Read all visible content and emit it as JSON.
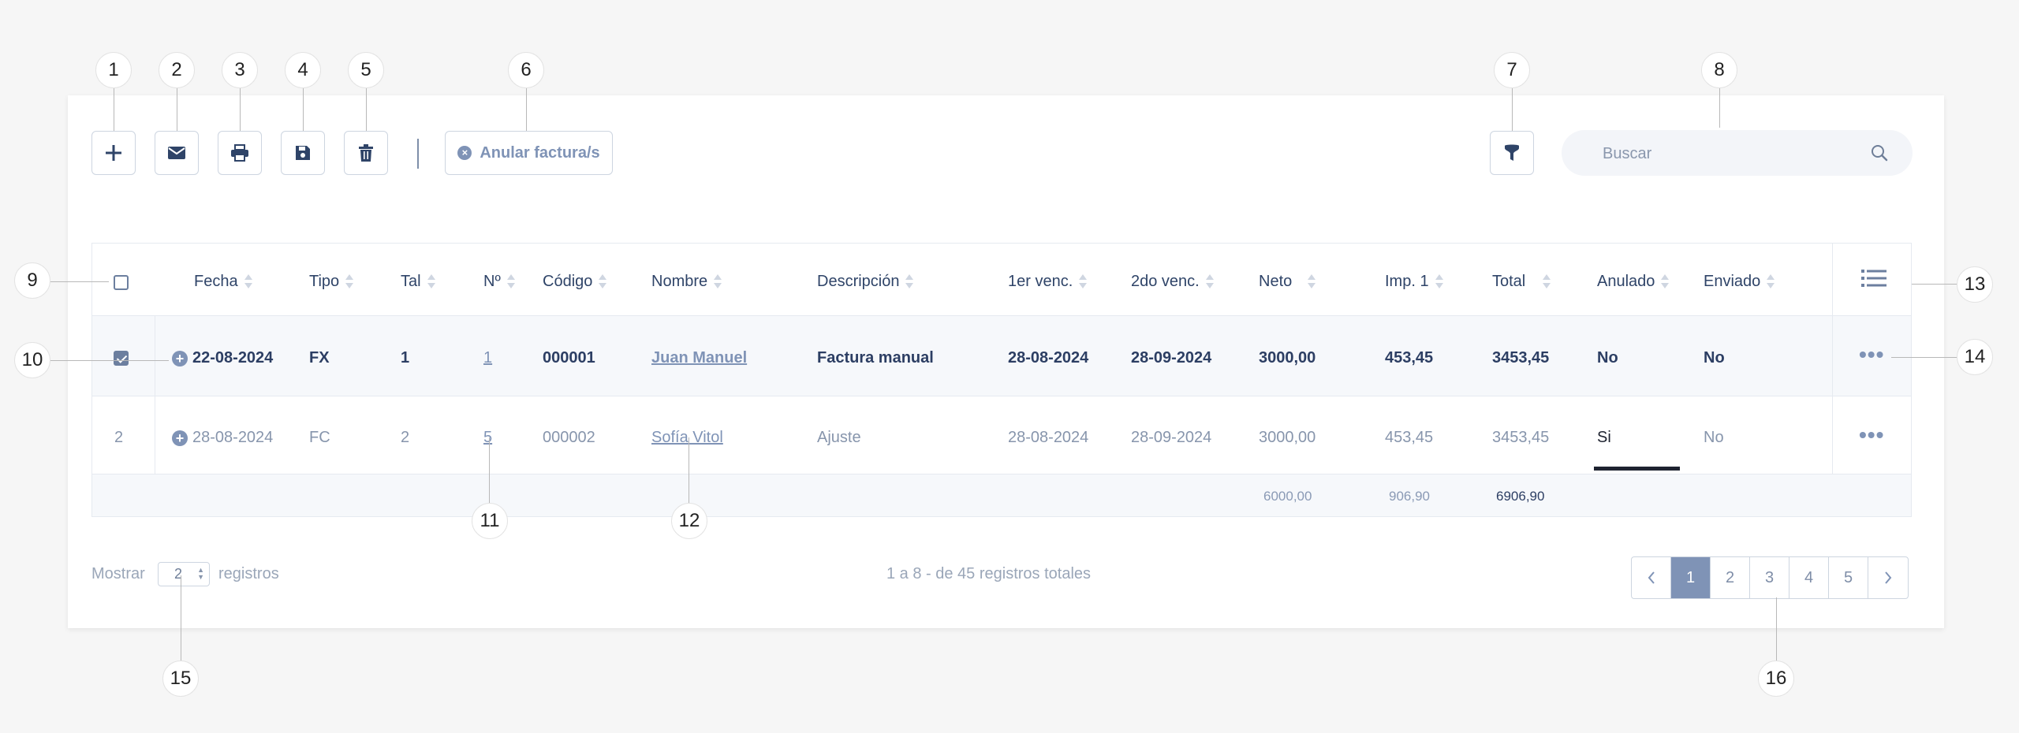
{
  "toolbar": {
    "annul_label": "Anular factura/s"
  },
  "search": {
    "placeholder": "Buscar"
  },
  "table": {
    "headers": [
      "Fecha",
      "Tipo",
      "Tal",
      "Nº",
      "Código",
      "Nombre",
      "Descripción",
      "1er venc.",
      "2do venc.",
      "Neto",
      "Imp. 1",
      "Total",
      "Anulado",
      "Enviado"
    ],
    "rows": [
      {
        "index": "",
        "checked": true,
        "fecha": "22-08-2024",
        "tipo": "FX",
        "tal": "1",
        "numero": "1",
        "codigo": "000001",
        "nombre": "Juan Manuel",
        "descripcion": "Factura manual",
        "venc1": "28-08-2024",
        "venc2": "28-09-2024",
        "neto": "3000,00",
        "imp1": "453,45",
        "total": "3453,45",
        "anulado": "No",
        "enviado": "No"
      },
      {
        "index": "2",
        "checked": false,
        "fecha": "28-08-2024",
        "tipo": "FC",
        "tal": "2",
        "numero": "5",
        "codigo": "000002",
        "nombre": "Sofía Vitol",
        "descripcion": "Ajuste",
        "venc1": "28-08-2024",
        "venc2": "28-09-2024",
        "neto": "3000,00",
        "imp1": "453,45",
        "total": "3453,45",
        "anulado": "Si",
        "enviado": "No"
      }
    ],
    "totals": {
      "neto": "6000,00",
      "imp1": "906,90",
      "total": "6906,90"
    }
  },
  "footer": {
    "show_label": "Mostrar",
    "show_value": "2",
    "records_label": "registros",
    "summary": "1 a 8 - de 45 registros totales",
    "pages": [
      "1",
      "2",
      "3",
      "4",
      "5"
    ],
    "active_page": "1"
  },
  "callouts": [
    "1",
    "2",
    "3",
    "4",
    "5",
    "6",
    "7",
    "8",
    "9",
    "10",
    "11",
    "12",
    "13",
    "14",
    "15",
    "16"
  ],
  "colors": {
    "accent": "#7f93b6",
    "text_dark": "#2c3e63",
    "text_muted": "#8795ac",
    "border": "#cdd5e0",
    "background": "#f6f6f6"
  }
}
